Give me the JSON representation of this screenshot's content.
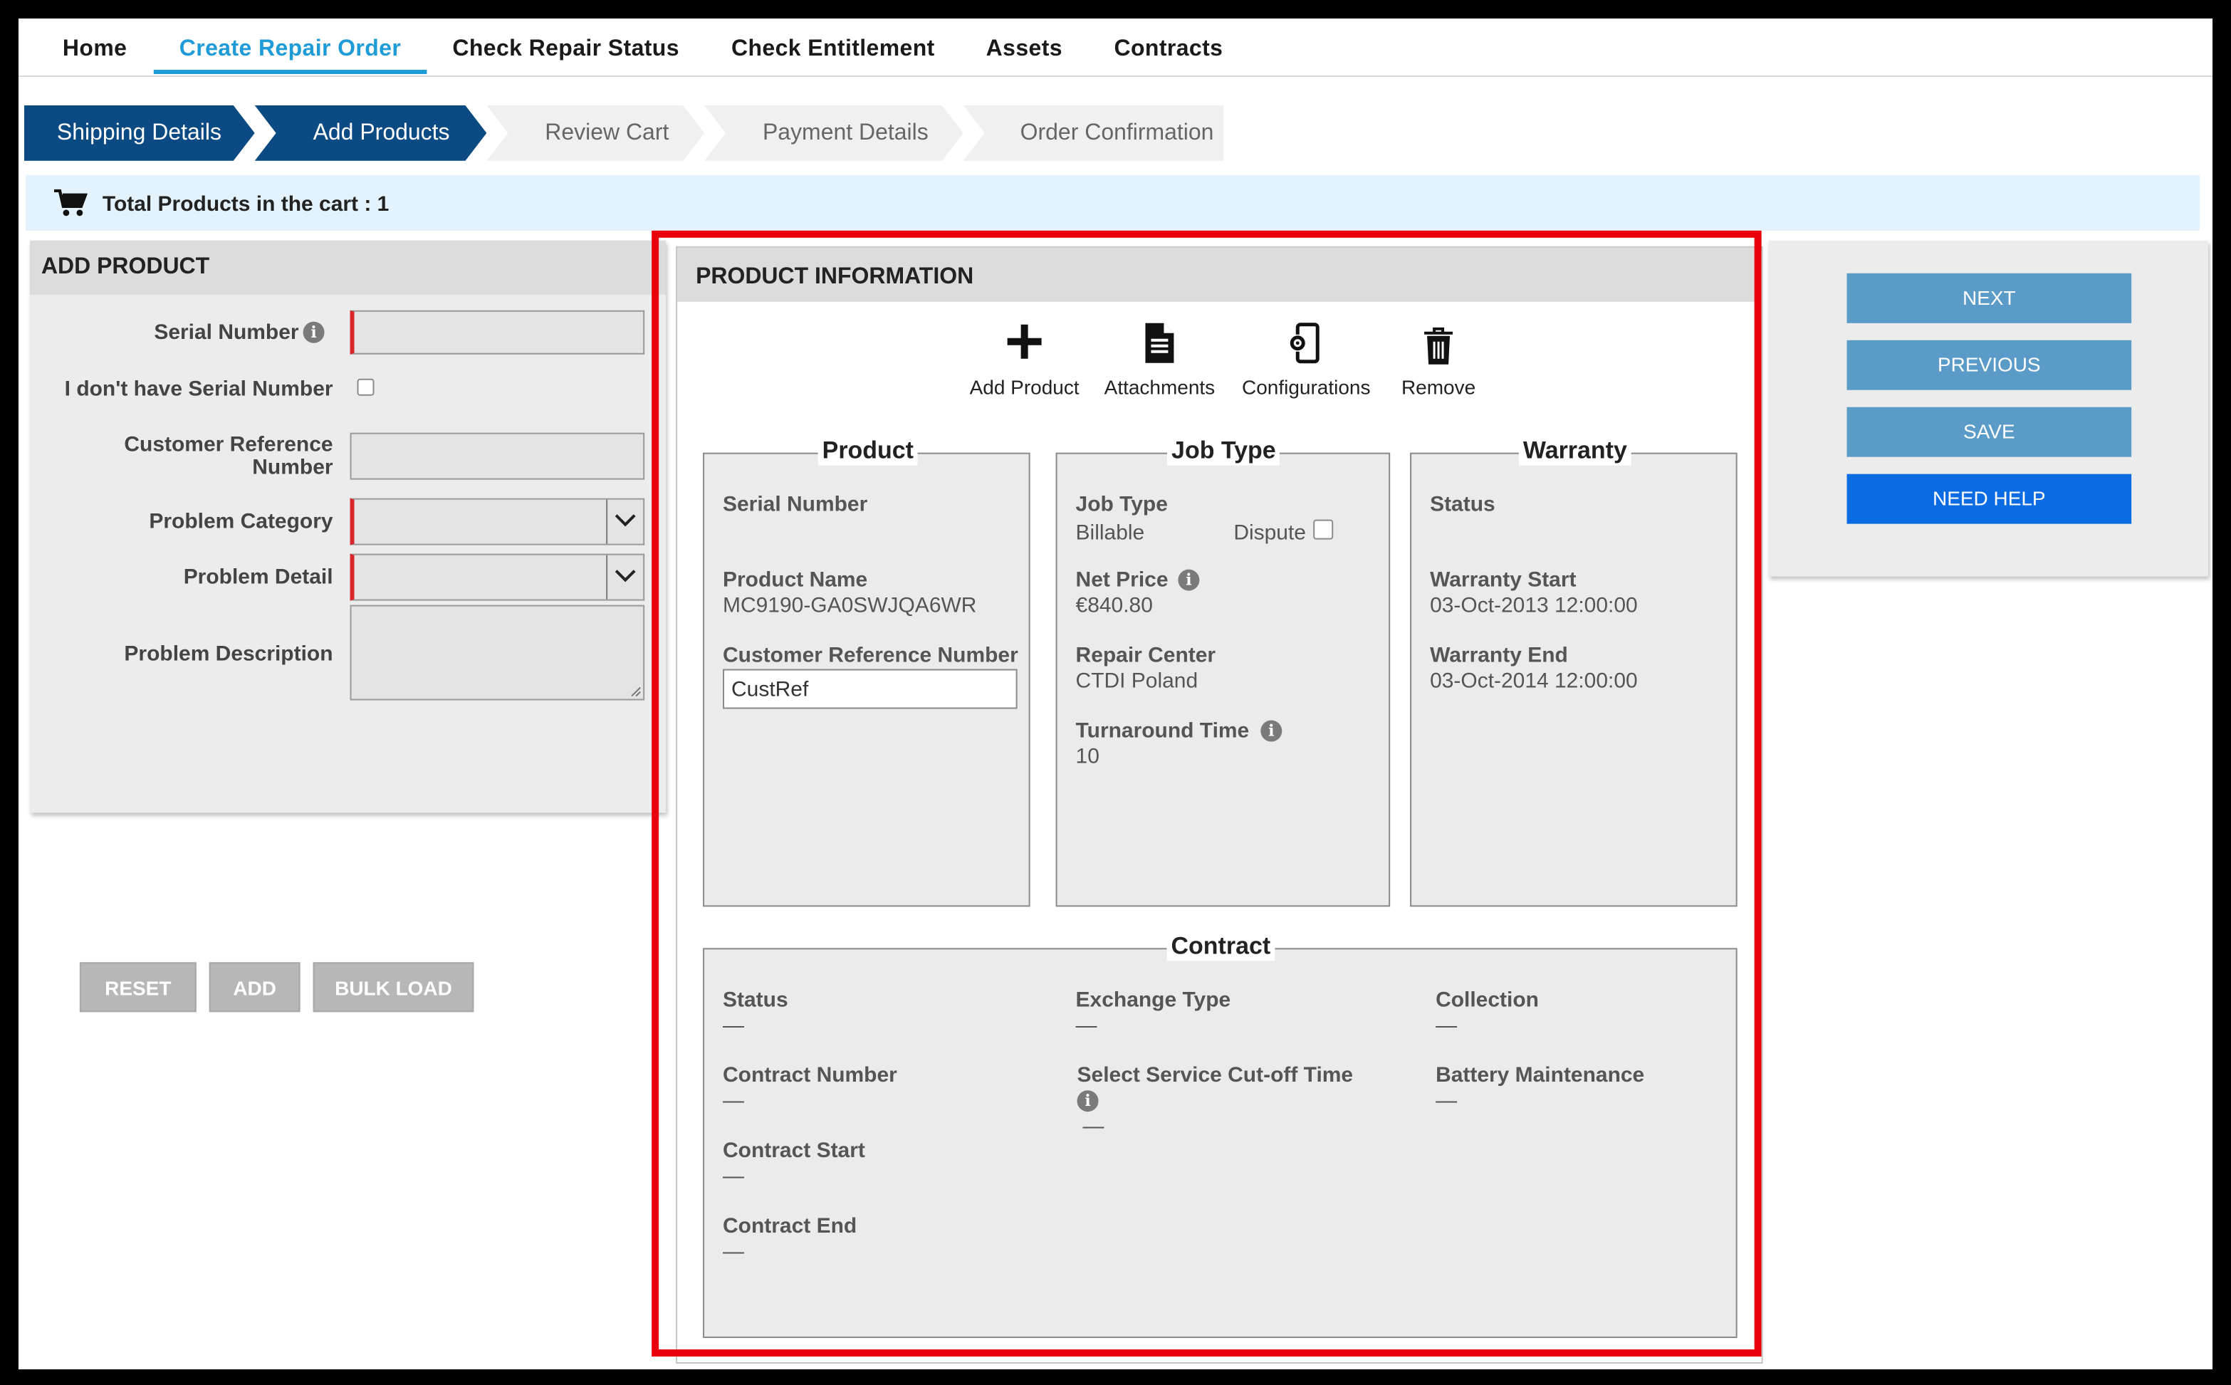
{
  "nav": {
    "items": [
      {
        "label": "Home"
      },
      {
        "label": "Create Repair Order"
      },
      {
        "label": "Check Repair Status"
      },
      {
        "label": "Check Entitlement"
      },
      {
        "label": "Assets"
      },
      {
        "label": "Contracts"
      }
    ],
    "active_index": 1
  },
  "wizard": {
    "steps": [
      {
        "label": "Shipping Details",
        "state": "complete"
      },
      {
        "label": "Add Products",
        "state": "current"
      },
      {
        "label": "Review Cart",
        "state": "pending"
      },
      {
        "label": "Payment Details",
        "state": "pending"
      },
      {
        "label": "Order Confirmation",
        "state": "pending"
      }
    ]
  },
  "cart": {
    "text": "Total Products in the cart : 1",
    "icon": "shopping-cart-icon"
  },
  "add_product": {
    "title": "ADD PRODUCT",
    "serial_number_label": "Serial Number",
    "serial_number_value": "",
    "no_serial_label": "I don't have Serial Number",
    "no_serial_checked": false,
    "customer_reference_label_line1": "Customer Reference",
    "customer_reference_label_line2": "Number",
    "customer_reference_value": "",
    "problem_category_label": "Problem Category",
    "problem_category_value": "",
    "problem_detail_label": "Problem Detail",
    "problem_detail_value": "",
    "problem_description_label": "Problem Description",
    "problem_description_value": "",
    "buttons": {
      "reset": "RESET",
      "add": "ADD",
      "bulk_load": "BULK LOAD"
    }
  },
  "product_information": {
    "title": "PRODUCT INFORMATION",
    "toolbar": {
      "add_product": "Add Product",
      "attachments": "Attachments",
      "configurations": "Configurations",
      "remove": "Remove"
    },
    "product": {
      "legend": "Product",
      "serial_number_label": "Serial Number",
      "product_name_label": "Product Name",
      "product_name_value": "MC9190-GA0SWJQA6WR",
      "customer_reference_label": "Customer Reference Number",
      "customer_reference_value": "CustRef"
    },
    "job_type": {
      "legend": "Job Type",
      "job_type_label": "Job Type",
      "job_type_value": "Billable",
      "dispute_label": "Dispute",
      "dispute_checked": false,
      "net_price_label": "Net Price",
      "net_price_value": "€840.80",
      "repair_center_label": "Repair Center",
      "repair_center_value": "CTDI Poland",
      "turnaround_label": "Turnaround Time",
      "turnaround_value": "10"
    },
    "warranty": {
      "legend": "Warranty",
      "status_label": "Status",
      "start_label": "Warranty Start",
      "start_value": "03-Oct-2013 12:00:00",
      "end_label": "Warranty End",
      "end_value": "03-Oct-2014 12:00:00"
    },
    "contract": {
      "legend": "Contract",
      "status_label": "Status",
      "status_value": "—",
      "contract_number_label": "Contract Number",
      "contract_number_value": "—",
      "contract_start_label": "Contract Start",
      "contract_start_value": "—",
      "contract_end_label": "Contract End",
      "contract_end_value": "—",
      "exchange_type_label": "Exchange Type",
      "exchange_type_value": "—",
      "cutoff_label": "Select Service Cut-off Time",
      "cutoff_value": "—",
      "collection_label": "Collection",
      "collection_value": "—",
      "battery_label": "Battery Maintenance",
      "battery_value": "—"
    }
  },
  "actions": {
    "next": "NEXT",
    "previous": "PREVIOUS",
    "save": "SAVE",
    "need_help": "NEED HELP"
  },
  "colors": {
    "accent_blue": "#1f9bd7",
    "wizard_active": "#0b4a82",
    "action_button": "#5b9bc8",
    "help_button": "#0a6be3",
    "highlight_border": "#e8000b",
    "required_marker": "#d9262a"
  }
}
